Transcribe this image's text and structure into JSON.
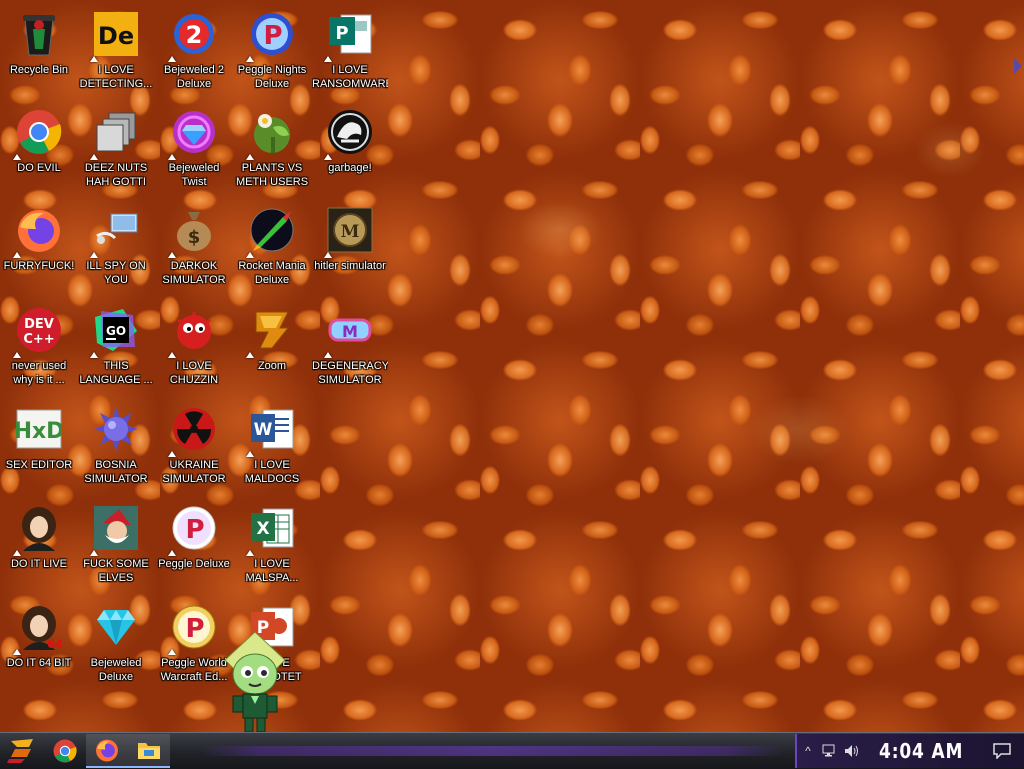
{
  "desktop": {
    "icons": [
      {
        "label": "Recycle Bin",
        "icon": "recycle-bin-icon"
      },
      {
        "label": "I LOVE\nDETECTING...",
        "icon": "detect-it-easy-icon"
      },
      {
        "label": "Bejeweled 2\nDeluxe",
        "icon": "bejeweled-2-icon"
      },
      {
        "label": "Peggle Nights\nDeluxe",
        "icon": "peggle-nights-icon"
      },
      {
        "label": "I LOVE\nRANSOMWARE",
        "icon": "publisher-icon"
      },
      {
        "label": "DO EVIL",
        "icon": "chrome-icon"
      },
      {
        "label": "DEEZ NUTS\nHAH GOTTI",
        "icon": "windows-stack-icon"
      },
      {
        "label": "Bejeweled\nTwist",
        "icon": "bejeweled-twist-icon"
      },
      {
        "label": "PLANTS VS\nMETH USERS",
        "icon": "plants-vs-zombies-icon"
      },
      {
        "label": "garbage!",
        "icon": "garbage-app-icon"
      },
      {
        "label": "FURRYFUCK!",
        "icon": "firefox-icon"
      },
      {
        "label": "ILL SPY ON\nYOU",
        "icon": "network-computer-icon"
      },
      {
        "label": "DARKOK\nSIMULATOR",
        "icon": "money-bag-icon"
      },
      {
        "label": "Rocket Mania\nDeluxe",
        "icon": "rocket-mania-icon"
      },
      {
        "label": "hitler simulator",
        "icon": "game-emblem-icon"
      },
      {
        "label": "never used\nwhy is it ...",
        "icon": "dev-cpp-icon"
      },
      {
        "label": "THIS\nLANGUAGE ...",
        "icon": "goland-icon"
      },
      {
        "label": "I LOVE\nCHUZZIN",
        "icon": "chuzzle-icon"
      },
      {
        "label": "Zoom",
        "icon": "zuma-icon"
      },
      {
        "label": "DEGENERACY\nSIMULATOR",
        "icon": "vr-headset-icon"
      },
      {
        "label": "SEX EDITOR",
        "icon": "hxd-icon"
      },
      {
        "label": "BOSNIA\nSIMULATOR",
        "icon": "spiky-ball-icon"
      },
      {
        "label": "UKRAINE\nSIMULATOR",
        "icon": "radiation-icon"
      },
      {
        "label": "I LOVE\nMALDOCS",
        "icon": "word-icon"
      },
      {
        "label": "DO IT LIVE",
        "icon": "portrait-icon"
      },
      {
        "label": "FUCK SOME\nELVES",
        "icon": "santa-icon"
      },
      {
        "label": "Peggle Deluxe",
        "icon": "peggle-icon"
      },
      {
        "label": "I LOVE\nMALSPA...",
        "icon": "excel-icon"
      },
      {
        "label": "DO IT 64 BIT",
        "icon": "portrait-64-icon"
      },
      {
        "label": "Bejeweled\nDeluxe",
        "icon": "diamond-icon"
      },
      {
        "label": "Peggle World\nWarcraft Ed...",
        "icon": "peggle-wow-icon"
      },
      {
        "label": "I LOVE\nMALPOTET",
        "icon": "powerpoint-icon"
      }
    ]
  },
  "taskbar": {
    "start_icon": "start-logo-icon",
    "pinned": [
      {
        "name": "chrome-taskbar-button",
        "icon": "chrome-icon"
      },
      {
        "name": "firefox-taskbar-button",
        "icon": "firefox-icon"
      },
      {
        "name": "file-explorer-taskbar-button",
        "icon": "folder-icon"
      }
    ],
    "tray": {
      "chevron": "^",
      "clock": "4:04 AM"
    }
  },
  "colors": {
    "bean_orange": "#d86a1f",
    "sauce": "#b34a0f",
    "taskbar": "#1f2126",
    "accent_purple": "#6b46c2"
  }
}
